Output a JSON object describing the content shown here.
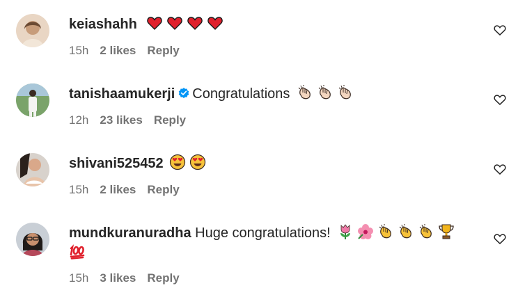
{
  "comments": [
    {
      "username": "keiashahh",
      "verified": false,
      "text": "",
      "emojis": [
        "red-heart",
        "red-heart",
        "red-heart",
        "red-heart"
      ],
      "time": "15h",
      "likes": "2 likes",
      "reply": "Reply"
    },
    {
      "username": "tanishaamukerji",
      "verified": true,
      "text": "Congratulations",
      "emojis": [
        "clapping-hands",
        "clapping-hands",
        "clapping-hands"
      ],
      "time": "12h",
      "likes": "23 likes",
      "reply": "Reply"
    },
    {
      "username": "shivani525452",
      "verified": false,
      "text": "",
      "emojis": [
        "heart-eyes-face",
        "heart-eyes-face"
      ],
      "time": "15h",
      "likes": "2 likes",
      "reply": "Reply"
    },
    {
      "username": "mundkuranuradha",
      "verified": false,
      "text": "Huge congratulations!",
      "emojis": [
        "tulip",
        "hibiscus",
        "clapping-hands",
        "clapping-hands",
        "clapping-hands",
        "trophy",
        "hundred-points"
      ],
      "time": "15h",
      "likes": "3 likes",
      "reply": "Reply"
    }
  ],
  "colors": {
    "text": "#262626",
    "meta": "#737373",
    "verified": "#0095f6",
    "heart": "#e0245e"
  }
}
